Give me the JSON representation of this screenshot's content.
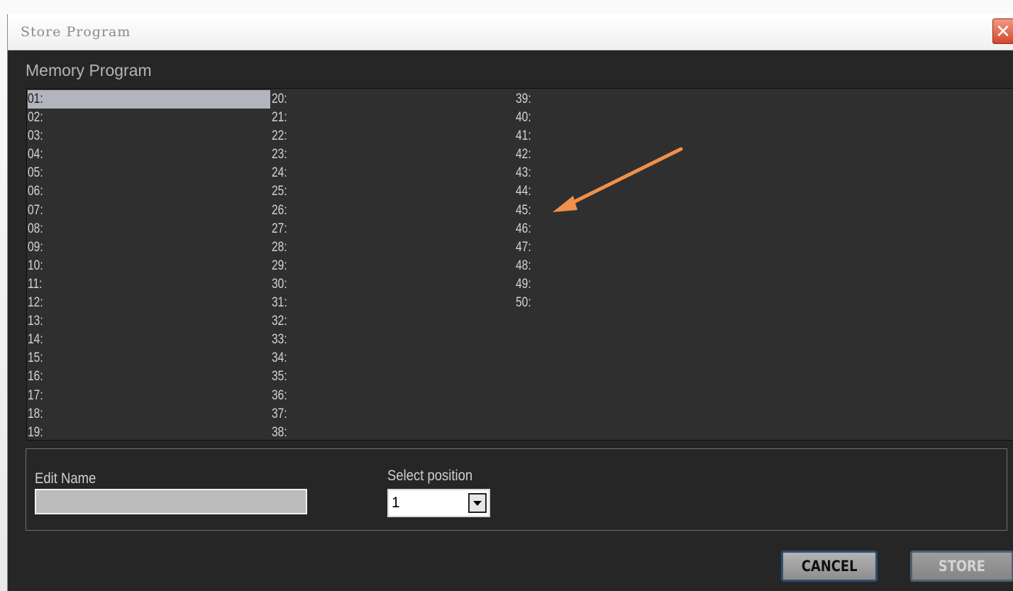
{
  "window": {
    "title": "Store Program",
    "close_glyph": "✕"
  },
  "memory": {
    "heading": "Memory Program",
    "selected_index": 0,
    "columns": [
      [
        "01:",
        "02:",
        "03:",
        "04:",
        "05:",
        "06:",
        "07:",
        "08:",
        "09:",
        "10:",
        "11:",
        "12:",
        "13:",
        "14:",
        "15:",
        "16:",
        "17:",
        "18:",
        "19:"
      ],
      [
        "20:",
        "21:",
        "22:",
        "23:",
        "24:",
        "25:",
        "26:",
        "27:",
        "28:",
        "29:",
        "30:",
        "31:",
        "32:",
        "33:",
        "34:",
        "35:",
        "36:",
        "37:",
        "38:"
      ],
      [
        "39:",
        "40:",
        "41:",
        "42:",
        "43:",
        "44:",
        "45:",
        "46:",
        "47:",
        "48:",
        "49:",
        "50:"
      ]
    ]
  },
  "edit": {
    "label": "Edit Name",
    "value": ""
  },
  "position": {
    "label": "Select position",
    "value": "1"
  },
  "buttons": {
    "cancel": "CANCEL",
    "store": "STORE"
  },
  "annotation": {
    "color": "#f0904a",
    "points_to": "45:"
  }
}
